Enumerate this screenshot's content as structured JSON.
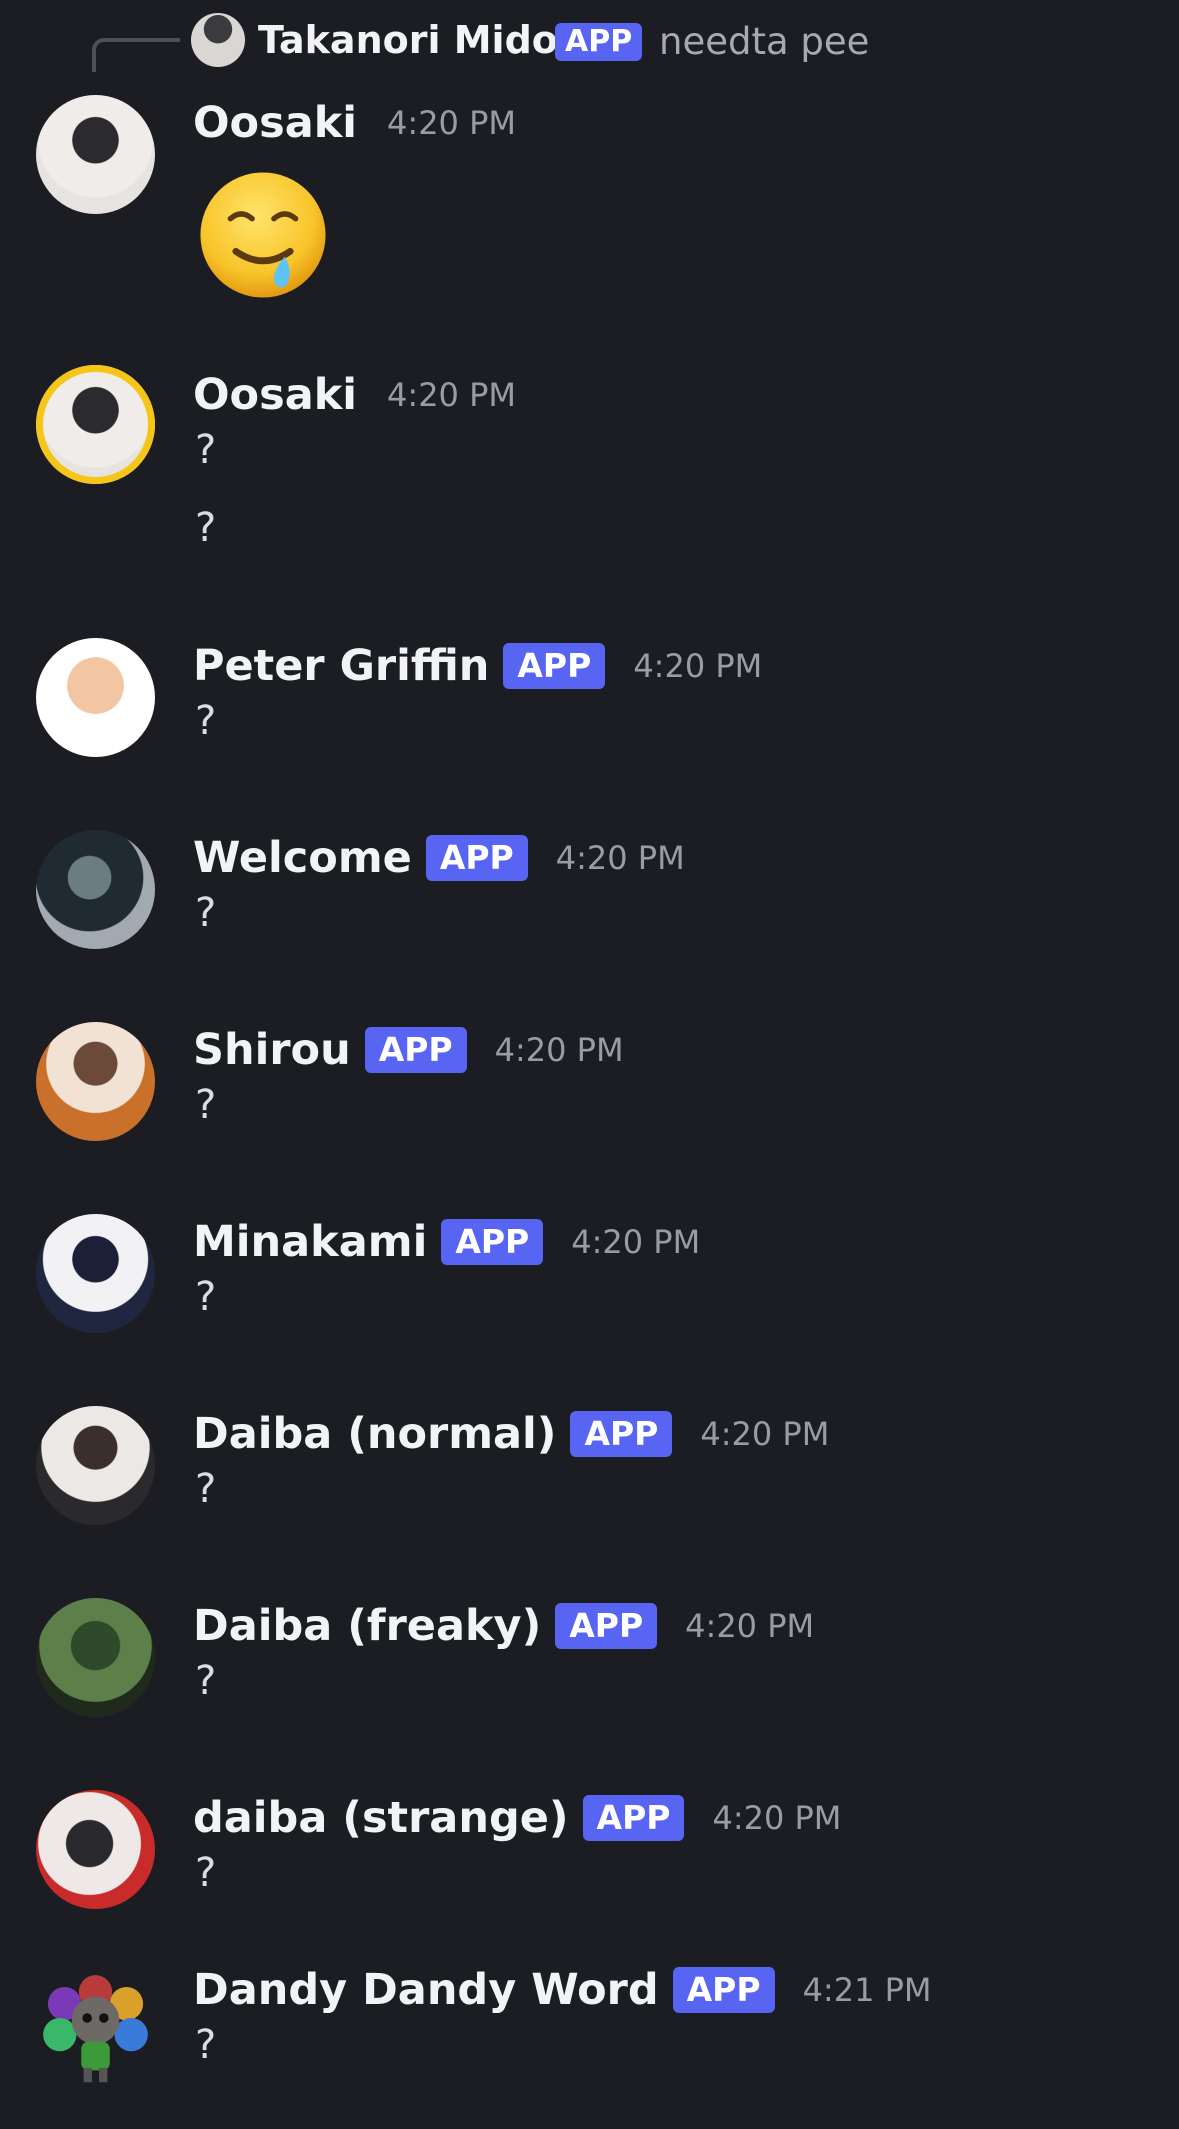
{
  "reply": {
    "name": "Takanori Midou",
    "tag": "APP",
    "text": "needta pee"
  },
  "messages": [
    {
      "name": "Oosaki",
      "tag": "",
      "time": "4:20 PM",
      "lines": [],
      "emoji": "drooling-face"
    },
    {
      "name": "Oosaki",
      "tag": "",
      "time": "4:20 PM",
      "lines": [
        "?",
        "?"
      ]
    },
    {
      "name": "Peter Griffin",
      "tag": "APP",
      "time": "4:20 PM",
      "lines": [
        "?"
      ]
    },
    {
      "name": "Welcome",
      "tag": "APP",
      "time": "4:20 PM",
      "lines": [
        "?"
      ]
    },
    {
      "name": "Shirou",
      "tag": "APP",
      "time": "4:20 PM",
      "lines": [
        "?"
      ]
    },
    {
      "name": "Minakami",
      "tag": "APP",
      "time": "4:20 PM",
      "lines": [
        "?"
      ]
    },
    {
      "name": "Daiba (normal)",
      "tag": "APP",
      "time": "4:20 PM",
      "lines": [
        "?"
      ]
    },
    {
      "name": "Daiba (freaky)",
      "tag": "APP",
      "time": "4:20 PM",
      "lines": [
        "?"
      ]
    },
    {
      "name": "daiba (strange)",
      "tag": "APP",
      "time": "4:20 PM",
      "lines": [
        "?"
      ]
    },
    {
      "name": "Dandy Dandy Word",
      "tag": "APP",
      "time": "4:21 PM",
      "lines": [
        "?"
      ]
    }
  ]
}
